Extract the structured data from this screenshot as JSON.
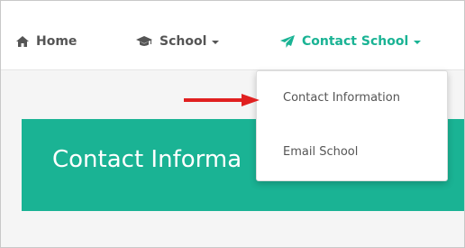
{
  "nav": {
    "home_label": "Home",
    "school_label": "School",
    "contact_label": "Contact School"
  },
  "dropdown": {
    "items": [
      {
        "label": "Contact Information"
      },
      {
        "label": "Email School"
      }
    ]
  },
  "banner": {
    "title": "Contact Informa"
  },
  "colors": {
    "accent": "#1ab394",
    "nav_text": "#555555",
    "annotation_arrow": "#e02020",
    "content_background": "#f5f5f5"
  },
  "icons": {
    "home": "home-icon",
    "school": "graduation-cap-icon",
    "contact": "paper-plane-icon",
    "caret": "caret-down-icon",
    "annotation": "red-arrow-icon"
  }
}
